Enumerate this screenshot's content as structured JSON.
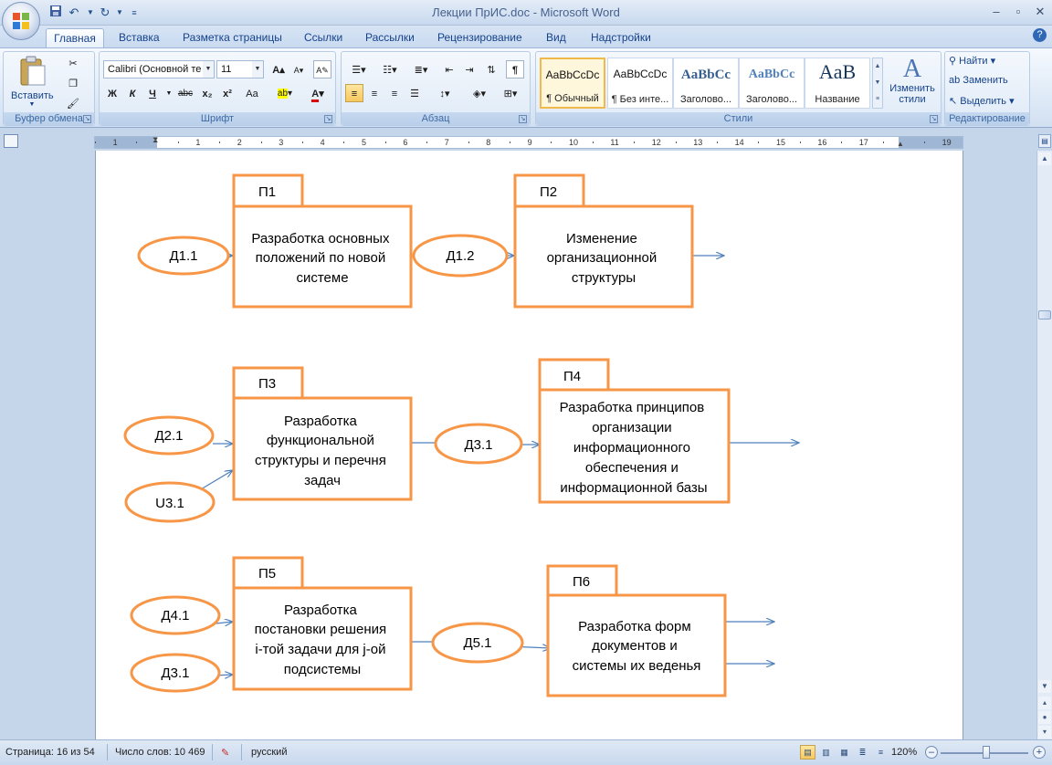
{
  "window": {
    "title": "Лекции ПрИС.doc - Microsoft Word",
    "controls": [
      "minimize",
      "maximize",
      "close"
    ]
  },
  "quick_access": {
    "icons": [
      "save-icon",
      "undo-icon",
      "redo-icon",
      "customize-icon"
    ]
  },
  "tabs": [
    {
      "label": "Главная",
      "active": true
    },
    {
      "label": "Вставка"
    },
    {
      "label": "Разметка страницы"
    },
    {
      "label": "Ссылки"
    },
    {
      "label": "Рассылки"
    },
    {
      "label": "Рецензирование"
    },
    {
      "label": "Вид"
    },
    {
      "label": "Надстройки"
    }
  ],
  "ribbon": {
    "clipboard": {
      "label": "Буфер обмена",
      "paste_label": "Вставить"
    },
    "font": {
      "label": "Шрифт",
      "font_name": "Calibri (Основной те",
      "font_size": "11",
      "format_buttons": [
        "Ж",
        "К",
        "Ч",
        "abc",
        "x₂",
        "x²",
        "Aa"
      ]
    },
    "paragraph": {
      "label": "Абзац"
    },
    "styles": {
      "label": "Стили",
      "items": [
        {
          "sample": "AaBbCcDc",
          "name": "¶ Обычный"
        },
        {
          "sample": "AaBbCcDc",
          "name": "¶ Без инте..."
        },
        {
          "sample": "AaBbCc",
          "name": "Заголово..."
        },
        {
          "sample": "AaBbCc",
          "name": "Заголово..."
        },
        {
          "sample": "AaB",
          "name": "Название"
        }
      ],
      "change_styles_label": "Изменить стили"
    },
    "editing": {
      "label": "Редактирование",
      "find": "Найти",
      "replace": "Заменить",
      "select": "Выделить"
    }
  },
  "ruler": {
    "numbers": [
      "1",
      "1",
      "2",
      "3",
      "4",
      "5",
      "6",
      "7",
      "8",
      "9",
      "10",
      "11",
      "12",
      "13",
      "14",
      "15",
      "16",
      "17",
      "19"
    ]
  },
  "diagram": {
    "processes": [
      {
        "tag": "П1",
        "text": [
          "Разработка основных",
          "положений по новой",
          "системе"
        ]
      },
      {
        "tag": "П2",
        "text": [
          "Изменение",
          "организационной",
          "структуры"
        ]
      },
      {
        "tag": "П3",
        "text": [
          "Разработка",
          "функциональной",
          "структуры и перечня",
          "задач"
        ]
      },
      {
        "tag": "П4",
        "text": [
          "Разработка принципов",
          "организации",
          "информационного",
          "обеспечения и",
          "информационной базы"
        ]
      },
      {
        "tag": "П5",
        "text": [
          "Разработка",
          "постановки решения",
          "i-той задачи для j-ой",
          "подсистемы"
        ]
      },
      {
        "tag": "П6",
        "text": [
          "Разработка форм",
          "документов и",
          "системы их веденья"
        ]
      }
    ],
    "data_items": [
      "Д1.1",
      "Д1.2",
      "Д2.1",
      "U3.1",
      "Д3.1",
      "Д4.1",
      "Д3.1",
      "Д5.1"
    ]
  },
  "status": {
    "page": "Страница: 16 из 54",
    "words": "Число слов: 10 469",
    "language": "русский",
    "zoom": "120%"
  },
  "colors": {
    "diagram_orange": "#f79646",
    "arrow_blue": "#4f81bd",
    "ribbon_text": "#15428b"
  }
}
